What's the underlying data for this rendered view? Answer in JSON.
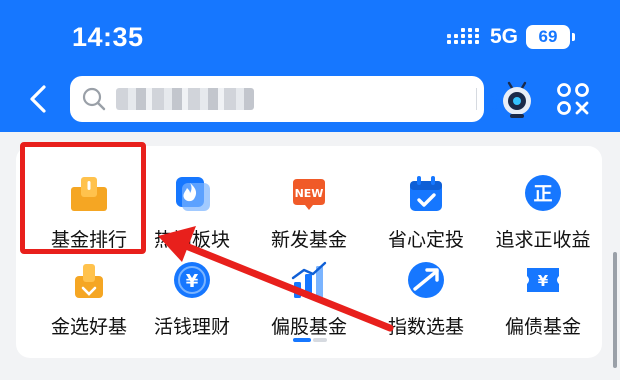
{
  "status_bar": {
    "time": "14:35",
    "network": "5G",
    "battery": "69"
  },
  "header": {
    "search_placeholder": "",
    "search_button": "搜索"
  },
  "grid": {
    "items": [
      {
        "label": "基金排行",
        "icon": "fund-ranking-icon",
        "color": "#f5a623"
      },
      {
        "label": "热门板块",
        "icon": "hot-sector-icon",
        "color": "#1677ff"
      },
      {
        "label": "新发基金",
        "icon": "new-badge-icon",
        "color": "#f05a28",
        "badge": "NEW"
      },
      {
        "label": "省心定投",
        "icon": "calendar-check-icon",
        "color": "#1677ff"
      },
      {
        "label": "追求正收益",
        "icon": "positive-return-icon",
        "color": "#1677ff",
        "badge": "正"
      },
      {
        "label": "金选好基",
        "icon": "gold-pick-icon",
        "color": "#f5a623"
      },
      {
        "label": "活钱理财",
        "icon": "yuan-coin-icon",
        "color": "#1677ff",
        "badge": "¥"
      },
      {
        "label": "偏股基金",
        "icon": "bar-chart-icon",
        "color": "#1677ff"
      },
      {
        "label": "指数选基",
        "icon": "index-trend-icon",
        "color": "#1677ff"
      },
      {
        "label": "偏债基金",
        "icon": "bond-ticket-icon",
        "color": "#1677ff",
        "badge": "¥"
      }
    ]
  },
  "colors": {
    "brand": "#1677ff",
    "annotation": "#e8201c"
  }
}
